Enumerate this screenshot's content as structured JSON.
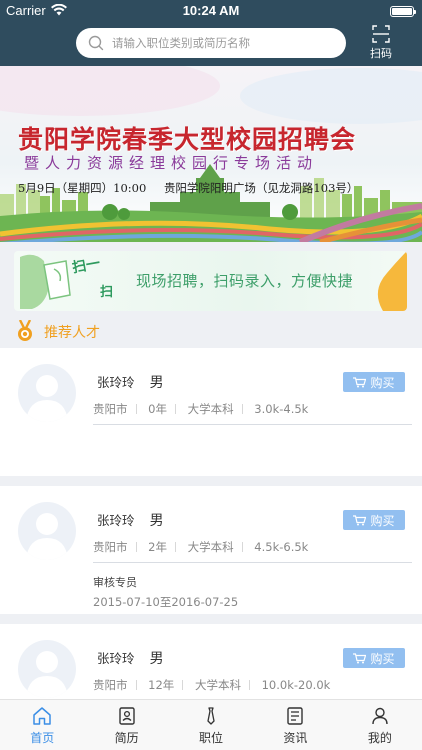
{
  "status_bar": {
    "carrier": "Carrier",
    "time": "10:24 AM"
  },
  "header": {
    "search_placeholder": "请输入职位类别或简历名称",
    "scan_label": "扫码"
  },
  "banner": {
    "title": "贵阳学院春季大型校园招聘会",
    "subtitle": "暨人力资源经理校园行专场活动",
    "date": "5月9日（星期四）10:00",
    "location": "贵阳学院阳明广场（见龙洞路103号）"
  },
  "scan_strip": {
    "art_text_1": "扫一",
    "art_text_2": "扫",
    "text": "现场招聘，扫码录入，方便快捷"
  },
  "section": {
    "title": "推荐人才"
  },
  "candidates": [
    {
      "name": "张玲玲",
      "gender": "男",
      "city": "贵阳市",
      "experience": "0年",
      "education": "大学本科",
      "salary": "3.0k-4.5k",
      "buy_label": "购买"
    },
    {
      "name": "张玲玲",
      "gender": "男",
      "city": "贵阳市",
      "experience": "2年",
      "education": "大学本科",
      "salary": "4.5k-6.5k",
      "buy_label": "购买",
      "job_title": "审核专员",
      "period": "2015-07-10至2016-07-25"
    },
    {
      "name": "张玲玲",
      "gender": "男",
      "city": "贵阳市",
      "experience": "12年",
      "education": "大学本科",
      "salary": "10.0k-20.0k",
      "buy_label": "购买"
    }
  ],
  "tabbar": {
    "items": [
      {
        "label": "首页",
        "icon": "home-icon",
        "active": true
      },
      {
        "label": "简历",
        "icon": "resume-icon",
        "active": false
      },
      {
        "label": "职位",
        "icon": "tie-icon",
        "active": false
      },
      {
        "label": "资讯",
        "icon": "news-icon",
        "active": false
      },
      {
        "label": "我的",
        "icon": "user-icon",
        "active": false
      }
    ]
  },
  "colors": {
    "header_bg": "#2f4c5e",
    "accent_blue": "#3a8ee6",
    "buy_button": "#92bff0",
    "section_orange": "#f0a020",
    "banner_title_red": "#c7262e"
  }
}
